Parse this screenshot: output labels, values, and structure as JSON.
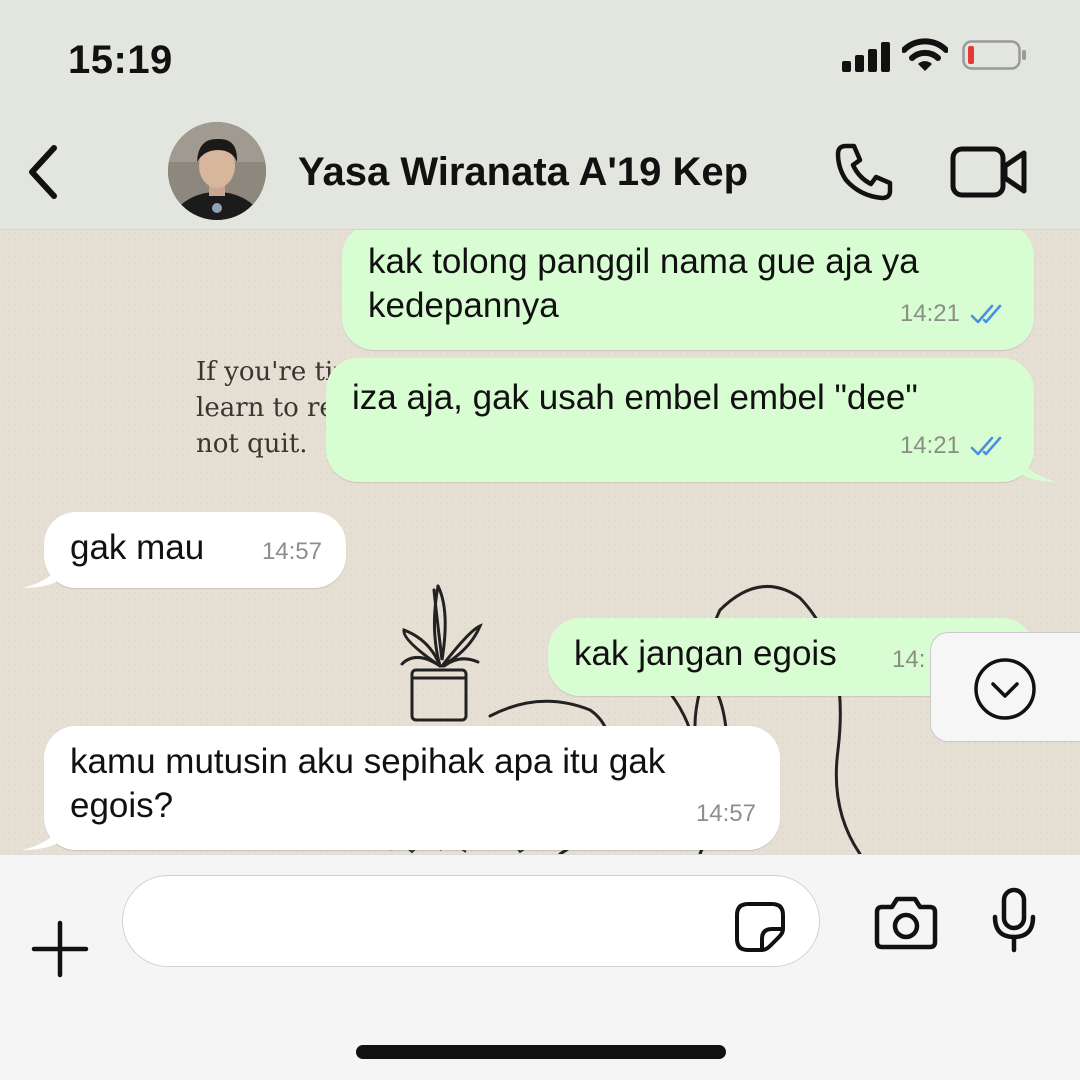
{
  "status_bar": {
    "time": "15:19"
  },
  "header": {
    "contact_name": "Yasa Wiranata A'19 Kep",
    "icons": [
      "back-icon",
      "phone-icon",
      "video-camera-icon"
    ]
  },
  "wallpaper": {
    "text_lines": [
      "If you're tir",
      "learn to res",
      "not quit."
    ]
  },
  "messages": [
    {
      "direction": "outgoing",
      "lines": [
        "kak tolong panggil nama gue aja ya",
        "kedepannya"
      ],
      "time": "14:21",
      "status": "read"
    },
    {
      "direction": "outgoing",
      "lines": [
        "iza aja, gak usah embel embel \"dee\""
      ],
      "time": "14:21",
      "status": "read"
    },
    {
      "direction": "incoming",
      "lines": [
        "gak mau"
      ],
      "time": "14:57"
    },
    {
      "direction": "outgoing",
      "lines": [
        "kak jangan egois"
      ],
      "time": "14:"
    },
    {
      "direction": "incoming",
      "lines": [
        "kamu mutusin aku sepihak apa itu gak",
        "egois?"
      ],
      "time": "14:57"
    }
  ],
  "composer": {
    "input_value": "",
    "input_placeholder": "",
    "icons": [
      "plus-icon",
      "sticker-icon",
      "camera-icon",
      "microphone-icon"
    ]
  },
  "colors": {
    "header_bg": "#e2e6df",
    "outgoing_bubble": "#d9fdd3",
    "incoming_bubble": "#ffffff",
    "read_ticks": "#4a90e2",
    "chat_bg": "#e6dfd3"
  }
}
